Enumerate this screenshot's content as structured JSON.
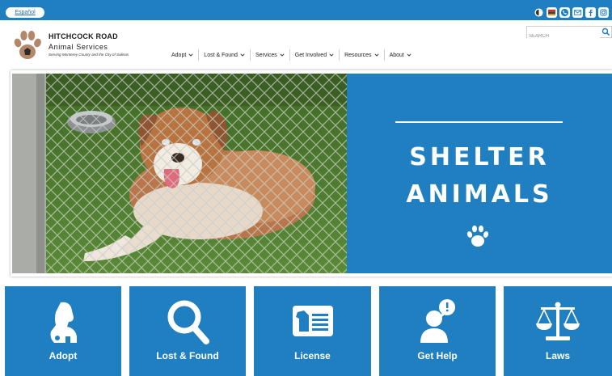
{
  "topbar": {
    "language_link": "Español",
    "social_icons": [
      "contrast-icon",
      "flag-icon",
      "phone-icon",
      "email-icon",
      "facebook-icon",
      "instagram-icon"
    ],
    "accent": "#1f7fc0"
  },
  "header": {
    "org_name": "HITCHCOCK ROAD",
    "org_sub": "Animal Services",
    "tagline": "Serving Monterey County and the City of Salinas",
    "logo_icon": "paw-logo-icon"
  },
  "nav": {
    "items": [
      "Adopt",
      "Lost & Found",
      "Services",
      "Get Involved",
      "Resources",
      "About"
    ]
  },
  "search": {
    "placeholder": "SEARCH"
  },
  "hero": {
    "line1": "SHELTER",
    "line2": "ANIMALS",
    "panel_color": "#1f7fc0"
  },
  "tiles": [
    {
      "label": "Adopt",
      "icon": "dog-icon"
    },
    {
      "label": "Lost & Found",
      "icon": "magnifier-icon"
    },
    {
      "label": "License",
      "icon": "license-card-icon"
    },
    {
      "label": "Get Help",
      "icon": "person-alert-icon"
    },
    {
      "label": "Laws",
      "icon": "scales-icon"
    }
  ]
}
